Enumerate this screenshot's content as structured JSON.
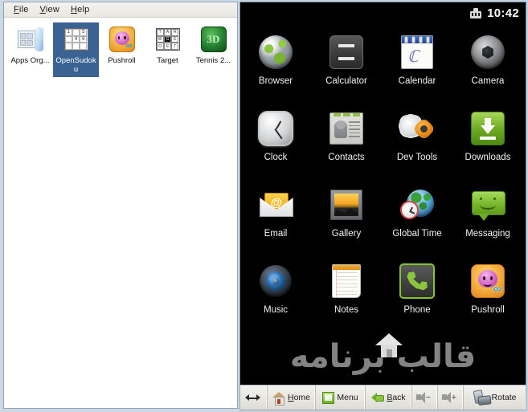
{
  "window": {
    "menubar": [
      {
        "name": "file",
        "accel": "F",
        "rest": "ile"
      },
      {
        "name": "view",
        "accel": "V",
        "rest": "iew"
      },
      {
        "name": "help",
        "accel": "H",
        "rest": "elp"
      }
    ]
  },
  "desktop": {
    "icons": [
      {
        "label": "Apps Org...",
        "icon": "apps-organizer-icon",
        "selected": false
      },
      {
        "label": "OpenSudoku",
        "icon": "opensudoku-icon",
        "selected": true
      },
      {
        "label": "Pushroll",
        "icon": "pushroll-icon",
        "selected": false
      },
      {
        "label": "Target",
        "icon": "target-icon",
        "selected": false
      },
      {
        "label": "Tennis 2...",
        "icon": "tennis-icon",
        "selected": false
      }
    ],
    "sudoku_cells": [
      "1",
      "",
      "5",
      "",
      "4",
      "6",
      "",
      "",
      ""
    ],
    "target_cells": [
      "T",
      "A",
      "R",
      "W",
      "G",
      "E",
      "O",
      "E",
      "T"
    ],
    "tennis_glyph": "3D"
  },
  "emulator": {
    "statusbar": {
      "usb_icon": "android-usb-debug-icon",
      "clock": "10:42"
    },
    "apps": [
      [
        {
          "label": "Browser",
          "icon": "browser-icon"
        },
        {
          "label": "Calculator",
          "icon": "calculator-icon"
        },
        {
          "label": "Calendar",
          "icon": "calendar-icon"
        },
        {
          "label": "Camera",
          "icon": "camera-icon"
        }
      ],
      [
        {
          "label": "Clock",
          "icon": "clock-icon"
        },
        {
          "label": "Contacts",
          "icon": "contacts-icon"
        },
        {
          "label": "Dev Tools",
          "icon": "dev-tools-icon"
        },
        {
          "label": "Downloads",
          "icon": "downloads-icon"
        }
      ],
      [
        {
          "label": "Email",
          "icon": "email-icon"
        },
        {
          "label": "Gallery",
          "icon": "gallery-icon"
        },
        {
          "label": "Global Time",
          "icon": "global-time-icon"
        },
        {
          "label": "Messaging",
          "icon": "messaging-icon"
        }
      ],
      [
        {
          "label": "Music",
          "icon": "music-icon"
        },
        {
          "label": "Notes",
          "icon": "notes-icon"
        },
        {
          "label": "Phone",
          "icon": "phone-icon"
        },
        {
          "label": "Pushroll",
          "icon": "pushroll-icon"
        }
      ]
    ],
    "watermark": {
      "text": "قالب برنامه",
      "house_icon": "house-icon",
      "color": "#9a9a9a"
    },
    "toolbar": [
      {
        "name": "resize",
        "icon": "resize-arrows-icon",
        "label": "",
        "accel": ""
      },
      {
        "name": "home",
        "icon": "home-icon",
        "label": "Home",
        "accel": "H"
      },
      {
        "name": "menu",
        "icon": "menu-icon",
        "label": "Menu",
        "accel": ""
      },
      {
        "name": "back",
        "icon": "back-arrow-icon",
        "label": "Back",
        "accel": "B"
      },
      {
        "name": "volume-down",
        "icon": "volume-down-icon",
        "label": "",
        "accel": ""
      },
      {
        "name": "volume-up",
        "icon": "volume-up-icon",
        "label": "",
        "accel": ""
      },
      {
        "name": "rotate",
        "icon": "rotate-device-icon",
        "label": "Rotate",
        "accel": ""
      }
    ]
  },
  "colors": {
    "emulator_bg": "#000000",
    "window_chrome": "#cdd8e5",
    "selection": "#3a6394",
    "android_green": "#8cc63f"
  }
}
